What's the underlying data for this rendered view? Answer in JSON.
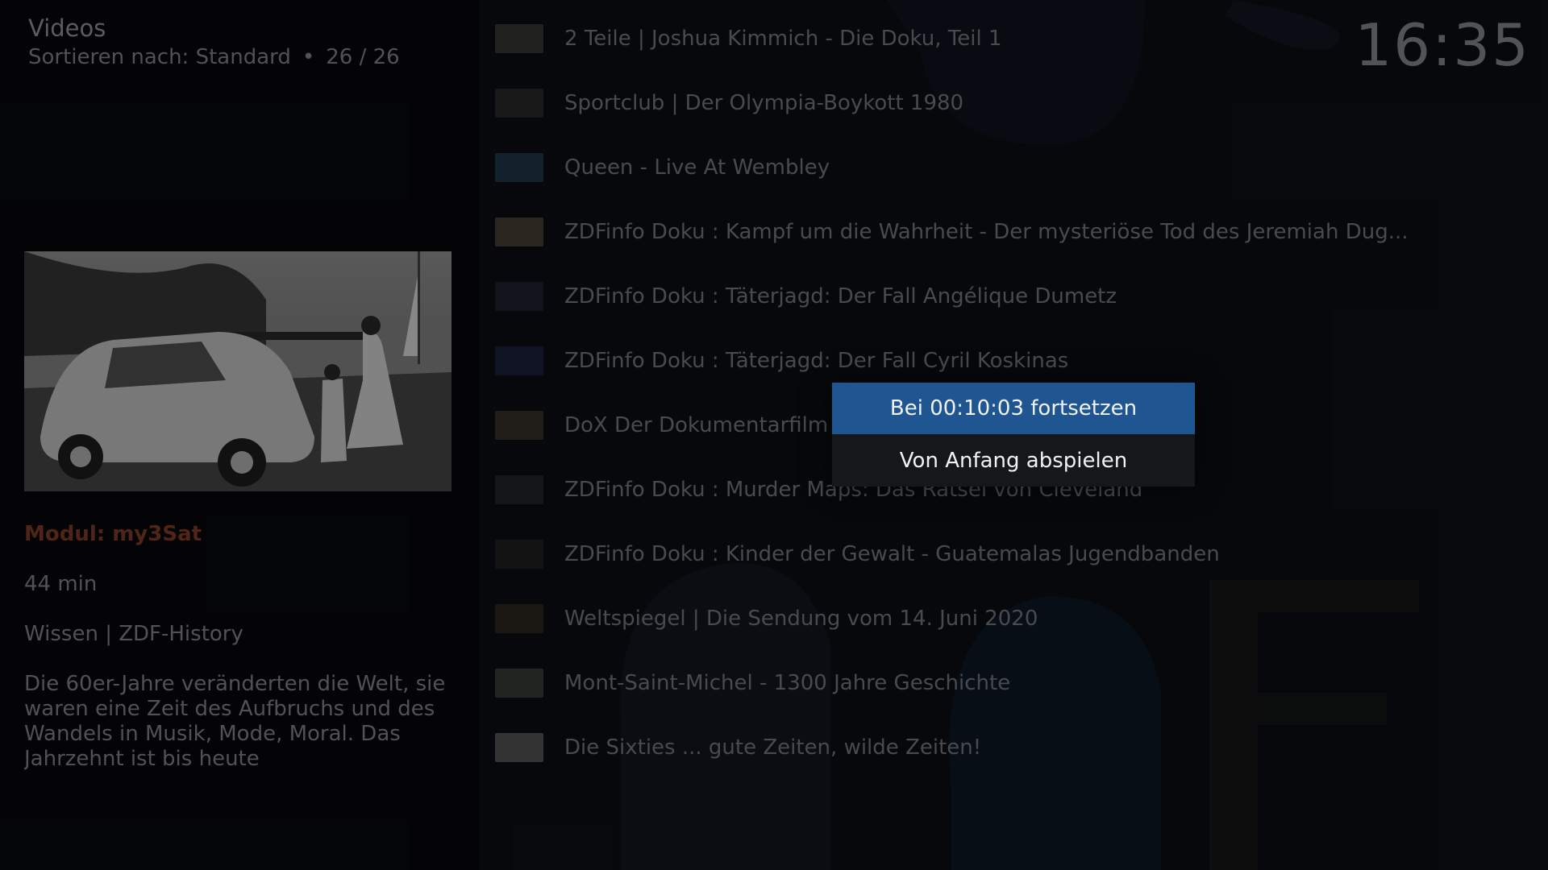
{
  "header": {
    "title": "Videos",
    "sort_label": "Sortieren nach: Standard",
    "separator": "•",
    "position": "26 / 26"
  },
  "clock": "16:35",
  "info": {
    "module": "Modul: my3Sat",
    "duration": "44 min",
    "genre": "Wissen | ZDF-History",
    "plot": "Die 60er-Jahre veränderten die Welt, sie waren eine Zeit des Aufbruchs und des Wandels in Musik, Mode, Moral. Das Jahrzehnt ist bis heute"
  },
  "list": [
    {
      "label": "2 Teile   | Joshua Kimmich - Die Doku, Teil 1",
      "thumb_color": "#3a3a36"
    },
    {
      "label": "Sportclub | Der Olympia-Boykott 1980",
      "thumb_color": "#2c2c2c"
    },
    {
      "label": "Queen - Live At Wembley",
      "thumb_color": "#1f3a4a"
    },
    {
      "label": "ZDFinfo Doku : Kampf um die Wahrheit - Der mysteriöse Tod des Jeremiah Dug...",
      "thumb_color": "#4a4038"
    },
    {
      "label": "ZDFinfo Doku : Täterjagd: Der Fall Angélique Dumetz",
      "thumb_color": "#1e2430"
    },
    {
      "label": "ZDFinfo Doku : Täterjagd: Der Fall Cyril Koskinas",
      "thumb_color": "#1c2440"
    },
    {
      "label": "DoX Der Dokumentarfilm",
      "thumb_color": "#3a322c"
    },
    {
      "label": "ZDFinfo Doku : Murder Maps: Das Rätsel von Cleveland",
      "thumb_color": "#24282a"
    },
    {
      "label": "ZDFinfo Doku : Kinder der Gewalt - Guatemalas Jugendbanden",
      "thumb_color": "#222222"
    },
    {
      "label": "Weltspiegel | Die Sendung vom 14. Juni 2020",
      "thumb_color": "#2e2620"
    },
    {
      "label": "Mont-Saint-Michel - 1300 Jahre Geschichte",
      "thumb_color": "#3a3e3a"
    },
    {
      "label": "Die Sixties ... gute Zeiten, wilde Zeiten!",
      "thumb_color": "#585858"
    }
  ],
  "dialog": {
    "resume_label": "Bei 00:10:03 fortsetzen",
    "start_label": "Von Anfang abspielen"
  },
  "colors": {
    "accent": "#1f5590",
    "module_text": "#8a3f28"
  }
}
